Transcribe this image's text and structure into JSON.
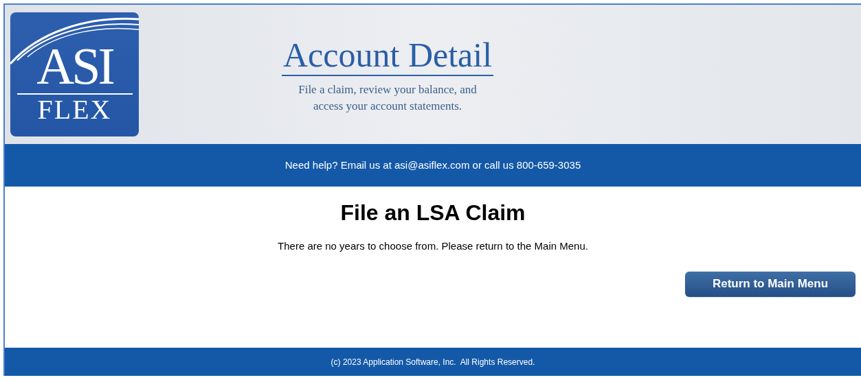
{
  "header": {
    "logo": {
      "line_1": "ASI",
      "line_2": "FLEX"
    },
    "title": "Account Detail",
    "subtitle_lines": [
      "File a claim, review your balance, and",
      "access your account statements."
    ]
  },
  "help_bar": {
    "text": "Need help? Email us at asi@asiflex.com or call us 800-659-3035"
  },
  "main": {
    "heading": "File an LSA Claim",
    "message": "There are no years to choose from. Please return to the Main Menu.",
    "button": "Return to Main Menu"
  },
  "footer": {
    "text": "(c) 2023 Application Software, Inc.  All Rights Reserved."
  }
}
